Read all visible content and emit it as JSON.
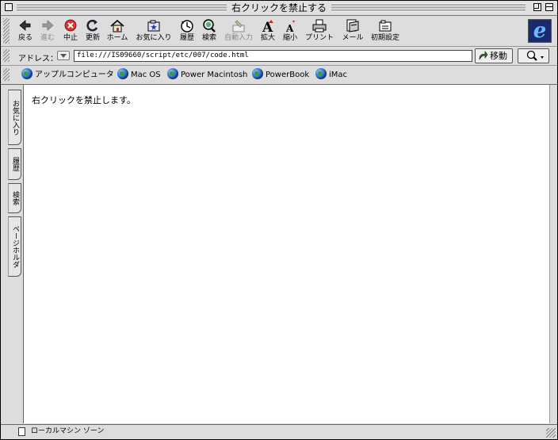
{
  "window": {
    "title": "右クリックを禁止する"
  },
  "toolbar": {
    "buttons": [
      {
        "label": "戻る",
        "icon": "back-arrow-icon",
        "enabled": true
      },
      {
        "label": "進む",
        "icon": "forward-arrow-icon",
        "enabled": false
      },
      {
        "label": "中止",
        "icon": "stop-icon",
        "enabled": true
      },
      {
        "label": "更新",
        "icon": "refresh-icon",
        "enabled": true
      },
      {
        "label": "ホーム",
        "icon": "home-icon",
        "enabled": true
      },
      {
        "label": "お気に入り",
        "icon": "favorites-icon",
        "enabled": true
      },
      {
        "label": "履歴",
        "icon": "history-clock-icon",
        "enabled": true
      },
      {
        "label": "検索",
        "icon": "search-icon",
        "enabled": true
      },
      {
        "label": "自動入力",
        "icon": "autofill-icon",
        "enabled": false
      },
      {
        "label": "拡大",
        "icon": "text-larger-icon",
        "enabled": true
      },
      {
        "label": "縮小",
        "icon": "text-smaller-icon",
        "enabled": true
      },
      {
        "label": "プリント",
        "icon": "printer-icon",
        "enabled": true
      },
      {
        "label": "メール",
        "icon": "mail-icon",
        "enabled": true
      },
      {
        "label": "初期設定",
        "icon": "preferences-icon",
        "enabled": true
      }
    ],
    "logo": "ie-logo-icon"
  },
  "address": {
    "label": "アドレス：",
    "url": "file:///IS09660/script/etc/007/code.html",
    "go_label": "移動"
  },
  "favorites_bar": {
    "items": [
      {
        "label": "アップルコンピュータ"
      },
      {
        "label": "Mac OS"
      },
      {
        "label": "Power Macintosh"
      },
      {
        "label": "PowerBook"
      },
      {
        "label": "iMac"
      }
    ]
  },
  "explorer_tabs": [
    {
      "label": "お気に入り"
    },
    {
      "label": "履歴"
    },
    {
      "label": "検索"
    },
    {
      "label": "ページホルダ"
    }
  ],
  "content": {
    "message": "右クリックを禁止します。"
  },
  "status": {
    "zone": "ローカルマシン ゾーン"
  },
  "colors": {
    "chrome": "#dddddd",
    "content_bg": "#ffffff",
    "ie_logo_bg": "#1a2a6c",
    "ie_logo_fg": "#6ab8ff"
  }
}
